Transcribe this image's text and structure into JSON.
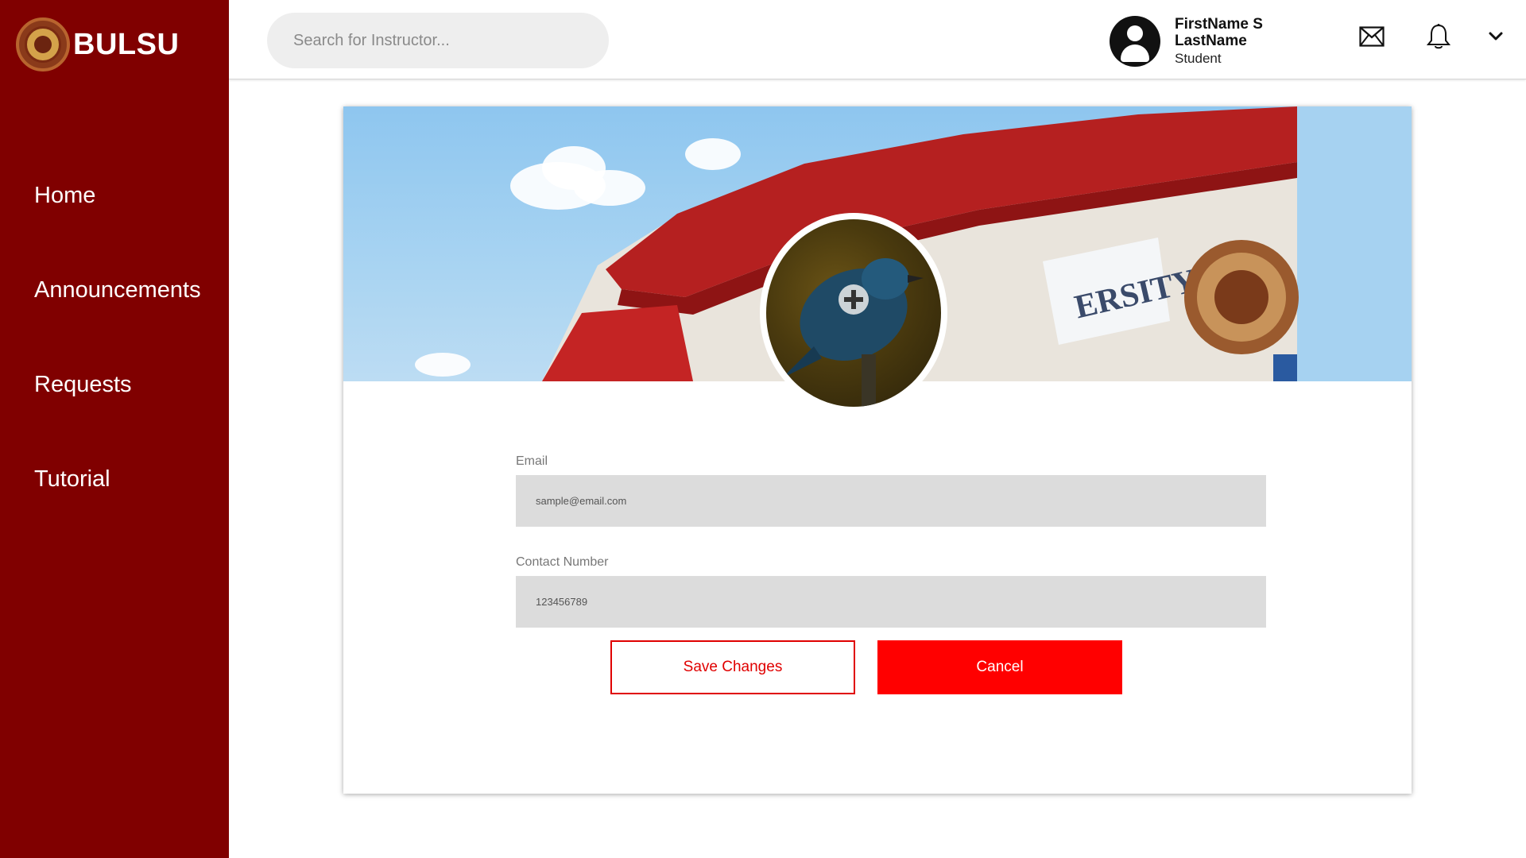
{
  "app": {
    "brand": "BULSU"
  },
  "sidebar": {
    "items": [
      {
        "label": "Home"
      },
      {
        "label": "Announcements"
      },
      {
        "label": "Requests"
      },
      {
        "label": "Tutorial"
      }
    ]
  },
  "header": {
    "search": {
      "placeholder": "Search for Instructor..."
    },
    "user": {
      "name": "FirstName S LastName",
      "role": "Student"
    },
    "icons": [
      "mail-icon",
      "bell-icon",
      "chevron-down-icon"
    ]
  },
  "profile": {
    "email": {
      "label": "Email",
      "value": "sample@email.com"
    },
    "contact": {
      "label": "Contact Number",
      "value": "123456789"
    },
    "actions": {
      "save_label": "Save Changes",
      "cancel_label": "Cancel"
    },
    "cover_sign": "ERSITY"
  },
  "colors": {
    "sidebar": "#800000",
    "accent": "#ff0000",
    "field_bg": "#dcdcdc",
    "search_bg": "#eeeeee"
  }
}
